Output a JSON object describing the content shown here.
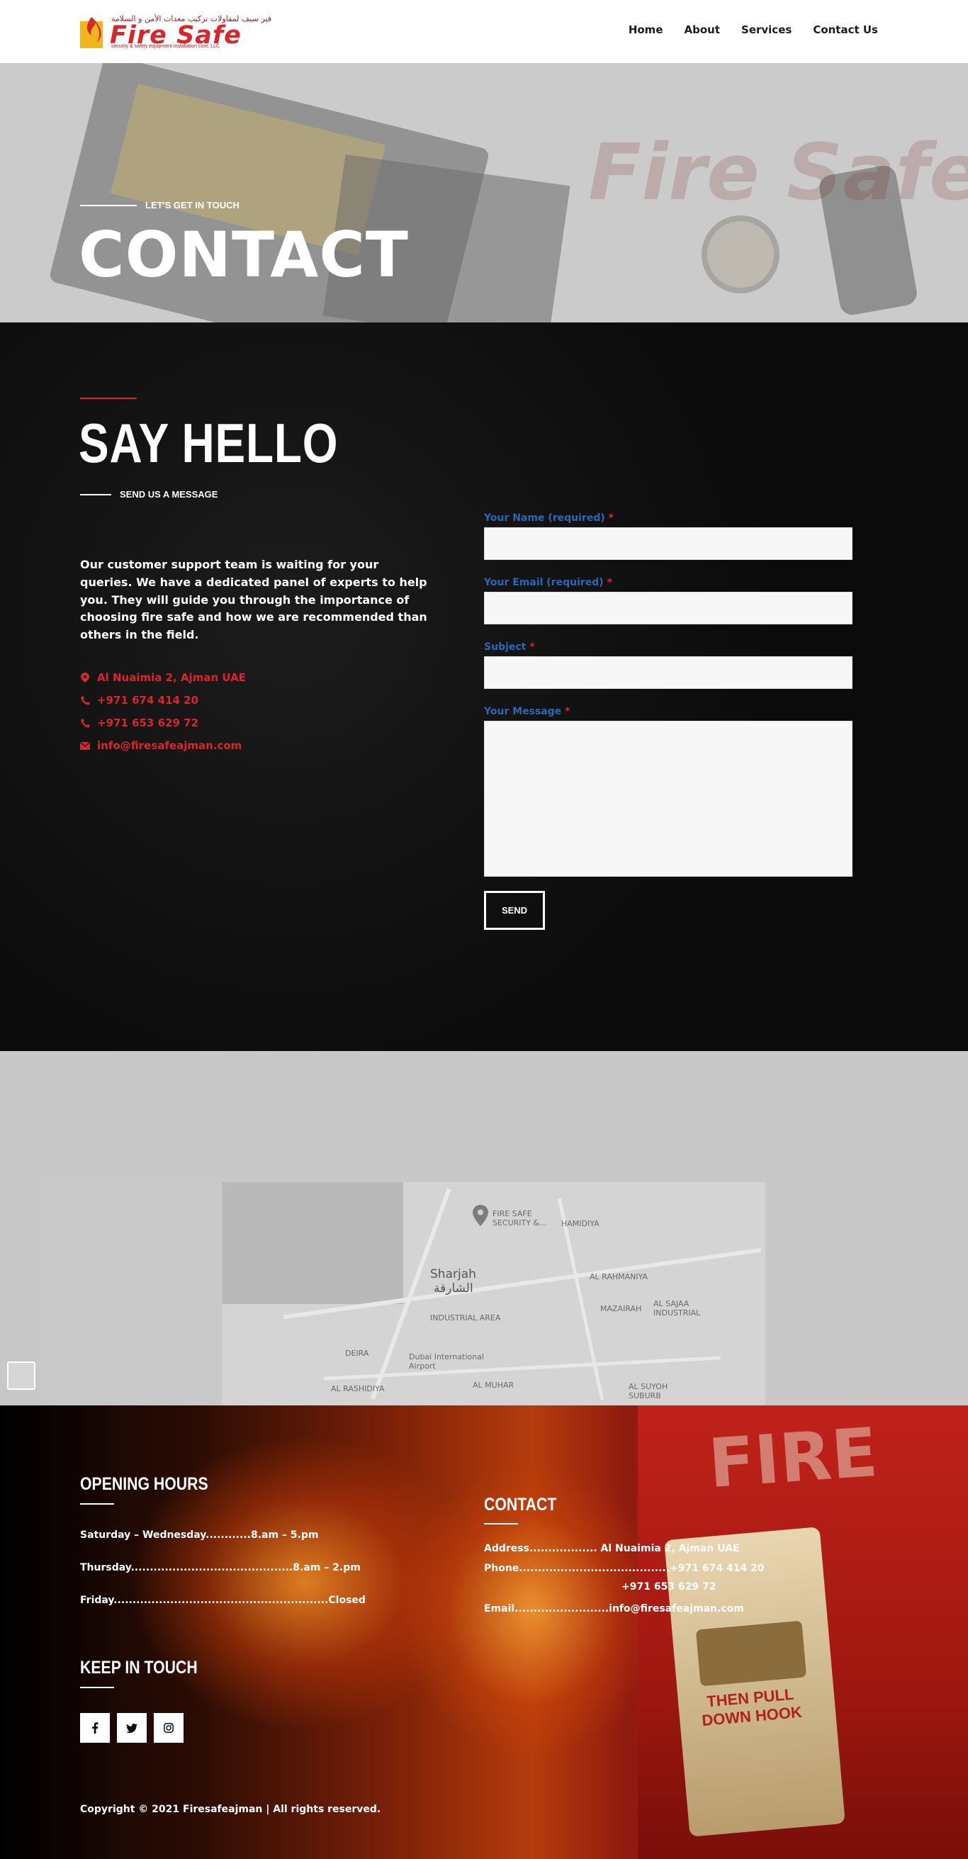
{
  "brand": {
    "arabic": "فير سيف لمقاولات تركيب معدات الأمن و السلامة",
    "name": "Fire Safe",
    "tagline": "security & safety equipment installation cont. LLC",
    "color": "#d7262c"
  },
  "nav": {
    "items": [
      {
        "label": "Home"
      },
      {
        "label": "About"
      },
      {
        "label": "Services"
      },
      {
        "label": "Contact Us"
      }
    ]
  },
  "hero": {
    "eyebrow": "LET'S GET IN TOUCH",
    "title": "CONTACT"
  },
  "contact": {
    "title": "SAY HELLO",
    "subtitle": "SEND US A MESSAGE",
    "intro": "Our customer support team is waiting for your queries. We have a dedicated panel of experts to help you. They will guide you through the importance of choosing fire safe and how we are recommended than others in the field.",
    "info": [
      {
        "icon": "map-marker-icon",
        "text": "Al Nuaimia 2, Ajman UAE"
      },
      {
        "icon": "phone-icon",
        "text": "+971 674 414 20"
      },
      {
        "icon": "phone-icon",
        "text": "+971 653 629 72"
      },
      {
        "icon": "envelope-icon",
        "text": "info@firesafeajman.com"
      }
    ],
    "form": {
      "name_label": "Your Name (required)",
      "email_label": "Your Email (required)",
      "subject_label": "Subject",
      "message_label": "Your Message",
      "required_mark": "*",
      "send_label": "SEND"
    }
  },
  "map": {
    "pin_label": "FIRE SAFE SECURITY &...",
    "labels": [
      "Sharjah",
      "الشارقة",
      "HAMIDIYA",
      "AL RAHMANIYA",
      "MAZAIRAH",
      "AL SAJAA INDUSTRIAL",
      "INDUSTRIAL AREA",
      "Dubai International Airport",
      "AL MUHAR",
      "AL SUYOH SUBURB",
      "DEIRA",
      "AL RASHIDIYA"
    ]
  },
  "footer": {
    "hours_title": "OPENING HOURS",
    "hours": [
      "Saturday – Wednesday............8.am – 5.pm",
      "Thursday...........................................8.am – 2.pm",
      "Friday.........................................................Closed"
    ],
    "keep_title": "KEEP IN TOUCH",
    "social": [
      {
        "icon": "facebook-icon"
      },
      {
        "icon": "twitter-icon"
      },
      {
        "icon": "instagram-icon"
      }
    ],
    "contact_title": "CONTACT",
    "address_line": "Address.................. Al Nuaimia 2, Ajman UAE",
    "phone_line": "Phone........................................+971 674 414 20",
    "phone_line2": "+971 653 629 72",
    "email_line": "Email.........................info@firesafeajman.com",
    "copyright": "Copyright © 2021 Firesafeajman | All rights reserved.",
    "alarm_fire": "FIRE",
    "alarm_text": "THEN PULL DOWN HOOK"
  }
}
